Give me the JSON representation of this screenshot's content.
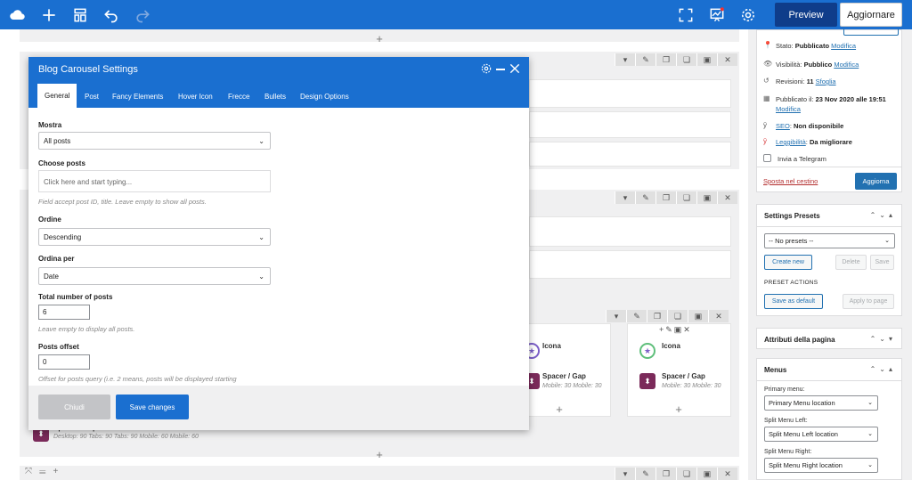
{
  "topbar": {
    "preview_label": "Preview",
    "update_label": "Aggiornare",
    "colors": {
      "bar": "#1a6fd0",
      "preview_bg": "#0f3d8a"
    }
  },
  "modal": {
    "title": "Blog Carousel Settings",
    "tabs": [
      "General",
      "Post",
      "Fancy Elements",
      "Hover Icon",
      "Frecce",
      "Bullets",
      "Design Options"
    ],
    "fields": {
      "mostra_label": "Mostra",
      "mostra_value": "All posts",
      "choose_label": "Choose posts",
      "choose_placeholder": "Click here and start typing...",
      "choose_help": "Field accept post ID, title. Leave empty to show all posts.",
      "ordine_label": "Ordine",
      "ordine_value": "Descending",
      "ordina_per_label": "Ordina per",
      "ordina_per_value": "Date",
      "total_label": "Total number of posts",
      "total_value": "6",
      "total_help": "Leave empty to display all posts.",
      "offset_label": "Posts offset",
      "offset_value": "0",
      "offset_help": "Offset for posts query (i.e. 2 means, posts will be displayed starting"
    },
    "close_label": "Chiudi",
    "save_label": "Save changes"
  },
  "builder": {
    "icona_label": "Icona",
    "spacer_label": "Spacer / Gap",
    "spacer_sub": "Mobile: 30   Mobile: 30",
    "spacer_bottom_label": "Spacer / Gap",
    "spacer_bottom_sub": "Desktop: 90   Tabs: 90   Tabs: 90   Mobile: 60   Mobile: 60"
  },
  "sidebar": {
    "publish": {
      "stato_label": "Stato:",
      "stato_value": "Pubblicato",
      "stato_link": "Modifica",
      "vis_label": "Visibilità:",
      "vis_value": "Pubblico",
      "vis_link": "Modifica",
      "rev_label": "Revisioni:",
      "rev_value": "11",
      "rev_link": "Sfoglia",
      "pub_label": "Pubblicato il:",
      "pub_value": "23 Nov 2020 alle 19:51",
      "pub_link": "Modifica",
      "seo_link": "SEO",
      "seo_value": "Non disponibile",
      "leg_link": "Leggibilità",
      "leg_value": "Da migliorare",
      "telegram_label": "Invia a Telegram",
      "trash_label": "Sposta nel cestino",
      "update_label": "Aggiorna"
    },
    "presets": {
      "title": "Settings Presets",
      "select_value": "-- No presets --",
      "create_label": "Create new",
      "delete_label": "Delete",
      "save_label": "Save",
      "actions_title": "PRESET ACTIONS",
      "default_label": "Save as default",
      "apply_label": "Apply to page"
    },
    "attributi": {
      "title": "Attributi della pagina"
    },
    "menus": {
      "title": "Menus",
      "primary_label": "Primary menu:",
      "primary_value": "Primary Menu location",
      "left_label": "Split Menu Left:",
      "left_value": "Split Menu Left location",
      "right_label": "Split Menu Right:",
      "right_value": "Split Menu Right location"
    }
  }
}
